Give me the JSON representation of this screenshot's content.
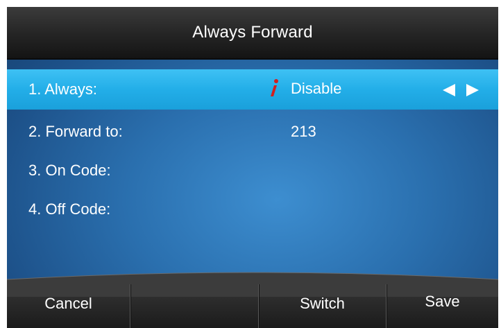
{
  "title": "Always Forward",
  "rows": [
    {
      "label": "1. Always:",
      "value": "Disable"
    },
    {
      "label": "2. Forward to:",
      "value": "213"
    },
    {
      "label": "3. On Code:",
      "value": ""
    },
    {
      "label": "4. Off Code:",
      "value": ""
    }
  ],
  "softkeys": [
    "Cancel",
    "",
    "Switch",
    "Save"
  ],
  "icons": {
    "info": "info-icon",
    "switch": "left-right-arrows-icon"
  },
  "colors": {
    "title_bar": "#242424",
    "selected_row": "#23aee8",
    "background": "#2a6fae",
    "info_icon": "#d21f1f",
    "text": "#ffffff"
  }
}
